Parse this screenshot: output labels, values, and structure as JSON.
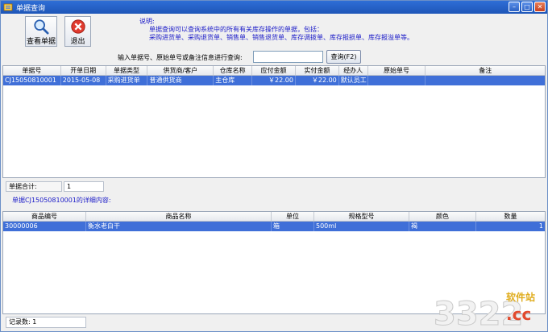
{
  "window": {
    "title": "单据查询"
  },
  "toolbar": {
    "view_label": "查看单据",
    "exit_label": "退出"
  },
  "notes": {
    "heading": "说明:",
    "line1": "单据查询可以查询系统中的所有有关库存操作的单据，包括：",
    "line2": "采购进货单、采购退货单、销售单、销售退货单、库存调拨单、库存报损单、库存报溢单等。"
  },
  "search": {
    "label": "输入单据号、原始单号或备注信息进行查询:",
    "value": "",
    "button_label": "查询(F2)"
  },
  "top_table": {
    "columns": [
      "单据号",
      "开单日期",
      "单据类型",
      "供货商/客户",
      "仓库名称",
      "应付金额",
      "实付金额",
      "经办人",
      "原始单号",
      "备注"
    ],
    "rows": [
      [
        "CJ15050810001",
        "2015-05-08",
        "采购进货单",
        "普通供货商",
        "主仓库",
        "￥22.00",
        "￥22.00",
        "默认员工",
        "",
        ""
      ]
    ]
  },
  "summary": {
    "label": "单据合计:",
    "value": "1"
  },
  "detail": {
    "title": "单据CJ15050810001的详细内容:"
  },
  "bottom_table": {
    "columns": [
      "商品编号",
      "商品名称",
      "单位",
      "规格型号",
      "颜色",
      "数量"
    ],
    "rows": [
      [
        "30000006",
        "衡水老白干",
        "箱",
        "500ml",
        "褐",
        "1"
      ]
    ]
  },
  "footer": {
    "record_label": "记录数:",
    "record_value": "1"
  },
  "watermark": {
    "digits": "3322",
    "site": "软件站",
    "domain": ".cc"
  },
  "colors": {
    "titlebar": "#2f6ed6",
    "selection": "#3f6fd8",
    "note_text": "#1a1ac8"
  }
}
